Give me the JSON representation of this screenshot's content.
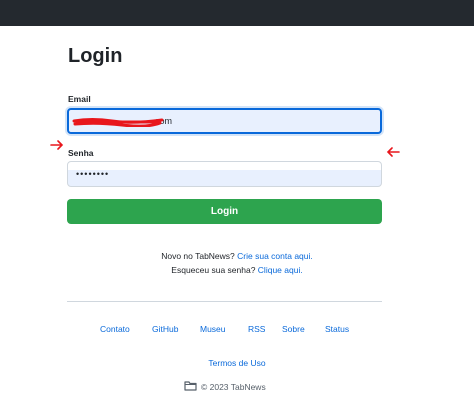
{
  "page": {
    "title": "Login"
  },
  "form": {
    "email_label": "Email",
    "email_value": "com",
    "password_label": "Senha",
    "password_value": "••••••••",
    "submit_label": "Login"
  },
  "help": {
    "signup_prefix": "Novo no TabNews?",
    "signup_link": "Crie sua conta aqui.",
    "forgot_prefix": "Esqueceu sua senha?",
    "forgot_link": "Clique aqui."
  },
  "footer": {
    "links": [
      "Contato",
      "GitHub",
      "Museu",
      "RSS",
      "Sobre",
      "Status"
    ],
    "terms": "Termos de Uso",
    "copyright": "© 2023 TabNews"
  },
  "colors": {
    "topbar": "#24292f",
    "primary_button": "#2da44e",
    "link": "#0969da",
    "annotation": "#e8161c"
  }
}
